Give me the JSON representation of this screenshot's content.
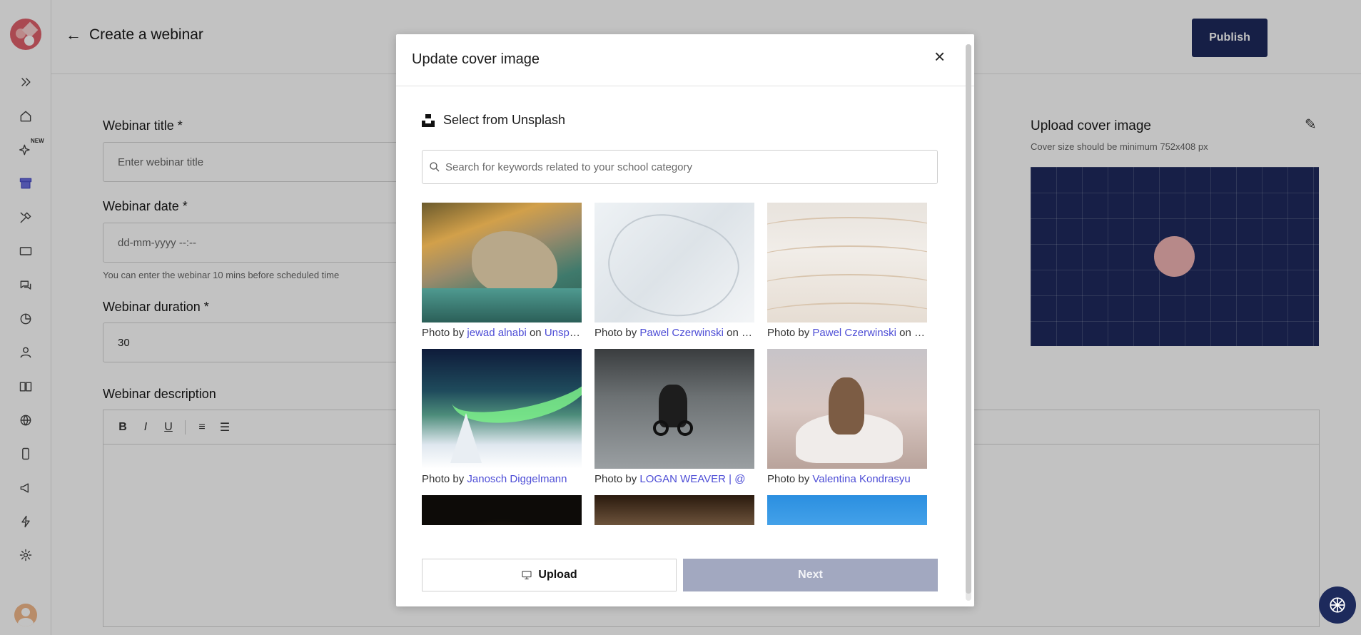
{
  "sidebar": {
    "new_badge": "NEW",
    "icons": [
      "chevrons-right-icon",
      "home-icon",
      "sparkle-icon",
      "archive-icon",
      "tools-icon",
      "ticket-icon",
      "chat-icon",
      "pie-chart-icon",
      "user-icon",
      "book-icon",
      "globe-icon",
      "mobile-icon",
      "megaphone-icon",
      "lightning-icon",
      "gear-icon"
    ]
  },
  "header": {
    "title": "Create a webinar",
    "publish_label": "Publish"
  },
  "form": {
    "title_label": "Webinar title *",
    "title_placeholder": "Enter webinar title",
    "date_label": "Webinar date *",
    "date_placeholder": "dd-mm-yyyy --:--",
    "date_hint": "You can enter the webinar 10 mins before scheduled time",
    "duration_label": "Webinar duration *",
    "duration_value": "30",
    "description_label": "Webinar description",
    "toolbar": [
      "B",
      "I",
      "U"
    ]
  },
  "cover": {
    "label": "Upload cover image",
    "hint": "Cover size should be minimum 752x408 px"
  },
  "modal": {
    "title": "Update cover image",
    "close_symbol": "×",
    "unsplash_title": "Select from Unsplash",
    "search_placeholder": "Search for keywords related to your school category",
    "photo_prefix": "Photo by",
    "on_text": "on",
    "site": "Unsplash",
    "photos": [
      {
        "author": "jewad alnabi",
        "caption_visible": "Photo by jewad alnabi on Uns..."
      },
      {
        "author": "Pawel Czerwinski",
        "caption_visible": "Photo by Pawel Czerwinski on ..."
      },
      {
        "author": "Pawel Czerwinski",
        "caption_visible": "Photo by Pawel Czerwinski on ..."
      },
      {
        "author": "Janosch Diggelmann",
        "caption_visible": "Photo by Janosch Diggelmann..."
      },
      {
        "author": "LOGAN WEAVER | @",
        "caption_visible": "Photo by LOGAN WEAVER | @..."
      },
      {
        "author": "Valentina Kondrasyu",
        "caption_visible": "Photo by Valentina Kondrasyu..."
      }
    ],
    "upload_label": "Upload",
    "next_label": "Next"
  },
  "colors": {
    "primary_dark": "#1d2a5c",
    "link": "#4e4ed6",
    "next_disabled": "#a2a8c0",
    "logo": "#e0606b"
  }
}
